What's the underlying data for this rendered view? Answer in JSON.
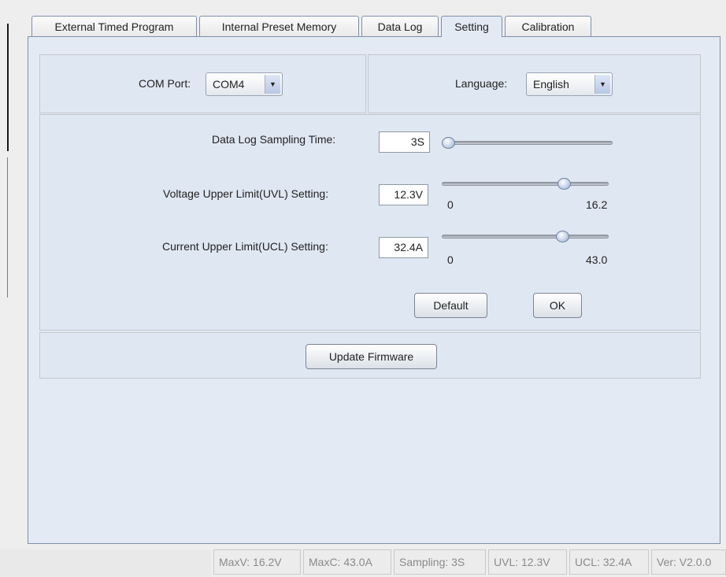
{
  "tabs": [
    {
      "label": "External Timed Program"
    },
    {
      "label": "Internal Preset Memory"
    },
    {
      "label": "Data Log"
    },
    {
      "label": "Setting",
      "active": true
    },
    {
      "label": "Calibration"
    }
  ],
  "com_port": {
    "label": "COM Port:",
    "value": "COM4"
  },
  "language": {
    "label": "Language:",
    "value": "English"
  },
  "sampling": {
    "label": "Data Log Sampling Time:",
    "value": "3S",
    "level": 0.0
  },
  "uvl": {
    "label": "Voltage Upper Limit(UVL) Setting:",
    "value": "12.3V",
    "min": "0",
    "max": "16.2",
    "level": 0.76
  },
  "ucl": {
    "label": "Current Upper Limit(UCL) Setting:",
    "value": "32.4A",
    "min": "0",
    "max": "43.0",
    "level": 0.75
  },
  "buttons": {
    "default": "Default",
    "ok": "OK",
    "update_firmware": "Update Firmware"
  },
  "status": {
    "maxv": "MaxV: 16.2V",
    "maxc": "MaxC: 43.0A",
    "sampling": "Sampling: 3S",
    "uvl": "UVL: 12.3V",
    "ucl": "UCL: 32.4A",
    "version": "Ver: V2.0.0"
  },
  "icons": {
    "dropdown": "chevron-down-icon",
    "slider_thumb": "slider-thumb-icon"
  }
}
